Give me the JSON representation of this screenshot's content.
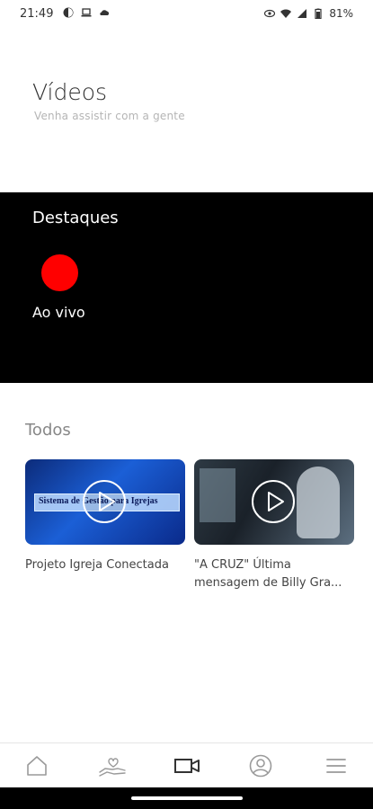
{
  "status_bar": {
    "time": "21:49",
    "battery": "81%"
  },
  "header": {
    "title": "Vídeos",
    "subtitle": "Venha assistir com a gente"
  },
  "featured": {
    "title": "Destaques",
    "live_label": "Ao vivo",
    "live_color": "#ff0000"
  },
  "all": {
    "title": "Todos",
    "videos": [
      {
        "title": "Projeto Igreja Conectada",
        "thumbnail_text": "Sistema de Gestão para Igrejas"
      },
      {
        "title": "\"A CRUZ\" Última mensagem de Billy Gra..."
      }
    ]
  },
  "bottom_nav": {
    "items": [
      {
        "icon": "home-icon"
      },
      {
        "icon": "donation-hand-icon"
      },
      {
        "icon": "video-camera-icon",
        "active": true
      },
      {
        "icon": "profile-icon"
      },
      {
        "icon": "menu-icon"
      }
    ]
  }
}
